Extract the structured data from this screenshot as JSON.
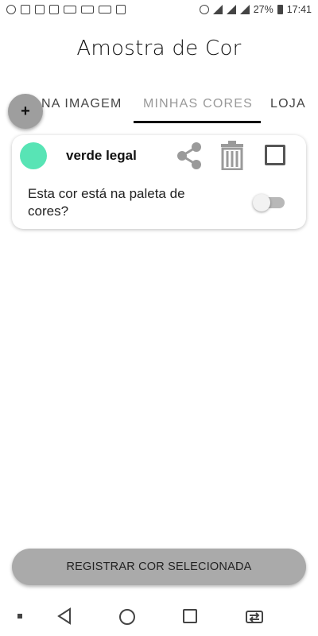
{
  "status_bar": {
    "battery": "27%",
    "time": "17:41"
  },
  "header": {
    "title": "Amostra de Cor"
  },
  "tabs": [
    {
      "label": "NA IMAGEM"
    },
    {
      "label": "MINHAS CORES",
      "selected": true
    },
    {
      "label": "LOJA"
    }
  ],
  "fab": {
    "label": "+",
    "icon": "add-icon"
  },
  "card": {
    "color_name": "verde legal",
    "swatch_color": "#58e4b5",
    "question": "Esta cor está na paleta de cores?",
    "toggle_on": false,
    "checked": false
  },
  "actions": {
    "register_label": "REGISTRAR COR SELECIONADA"
  },
  "nav": {
    "icons": [
      "back-icon",
      "home-icon",
      "recent-apps-icon",
      "switch-apps-icon"
    ]
  },
  "colors": {
    "accent": "#111111",
    "button_gray": "#aaaaaa"
  }
}
